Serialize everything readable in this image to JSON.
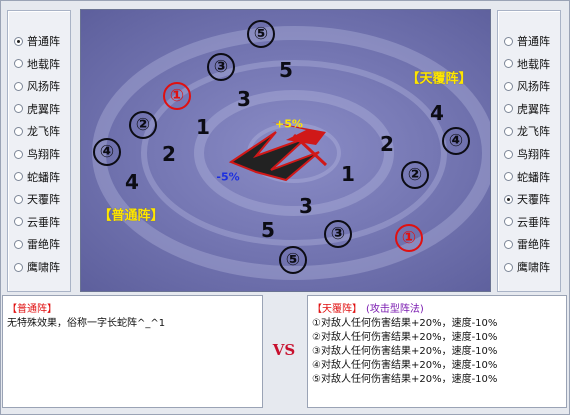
{
  "colors": {
    "battlefield_background": "#7678b4",
    "unit_dark": "#0c0c14",
    "unit_highlight": "#e01010",
    "formation_label": "#ffe600",
    "modifier_plus": "#ffe600",
    "modifier_minus": "#1c2fe0",
    "vs_text": "#c8102e"
  },
  "left_panel": {
    "options": [
      "普通阵",
      "地载阵",
      "风扬阵",
      "虎翼阵",
      "龙飞阵",
      "鸟翔阵",
      "蛇蟠阵",
      "天覆阵",
      "云垂阵",
      "雷绝阵",
      "鹰啸阵"
    ],
    "selected": "普通阵"
  },
  "right_panel": {
    "options": [
      "普通阵",
      "地载阵",
      "风扬阵",
      "虎翼阵",
      "龙飞阵",
      "鸟翔阵",
      "蛇蟠阵",
      "天覆阵",
      "云垂阵",
      "雷绝阵",
      "鹰啸阵"
    ],
    "selected": "天覆阵"
  },
  "battlefield": {
    "left_formation_label": "【普通阵】",
    "right_formation_label": "【天覆阵】",
    "modifier_plus": "+5%",
    "modifier_minus": "-5%",
    "center_icon": "clash-lightning-icon",
    "left_units": [
      {
        "label": "⑤",
        "style": "circled"
      },
      {
        "label": "③",
        "style": "circled"
      },
      {
        "label": "5",
        "style": "plain"
      },
      {
        "label": "3",
        "style": "plain"
      },
      {
        "label": "①",
        "style": "circled-red"
      },
      {
        "label": "1",
        "style": "plain"
      },
      {
        "label": "②",
        "style": "circled"
      },
      {
        "label": "2",
        "style": "plain"
      },
      {
        "label": "④",
        "style": "circled"
      },
      {
        "label": "4",
        "style": "plain"
      }
    ],
    "right_units": [
      {
        "label": "4",
        "style": "plain"
      },
      {
        "label": "④",
        "style": "circled"
      },
      {
        "label": "2",
        "style": "plain"
      },
      {
        "label": "②",
        "style": "circled"
      },
      {
        "label": "1",
        "style": "plain"
      },
      {
        "label": "3",
        "style": "plain"
      },
      {
        "label": "③",
        "style": "circled"
      },
      {
        "label": "5",
        "style": "plain"
      },
      {
        "label": "⑤",
        "style": "circled"
      },
      {
        "label": "①",
        "style": "circled-red"
      }
    ]
  },
  "left_info": {
    "title": "【普通阵】",
    "lines": [
      "无特殊效果，俗称一字长蛇阵^_^1"
    ]
  },
  "vs": "VS",
  "right_info": {
    "title": "【天覆阵】",
    "subtitle": "(攻击型阵法)",
    "lines": [
      "①对敌人任何伤害结果+20%，速度-10%",
      "②对敌人任何伤害结果+20%，速度-10%",
      "③对敌人任何伤害结果+20%，速度-10%",
      "④对敌人任何伤害结果+20%，速度-10%",
      "⑤对敌人任何伤害结果+20%，速度-10%"
    ]
  }
}
